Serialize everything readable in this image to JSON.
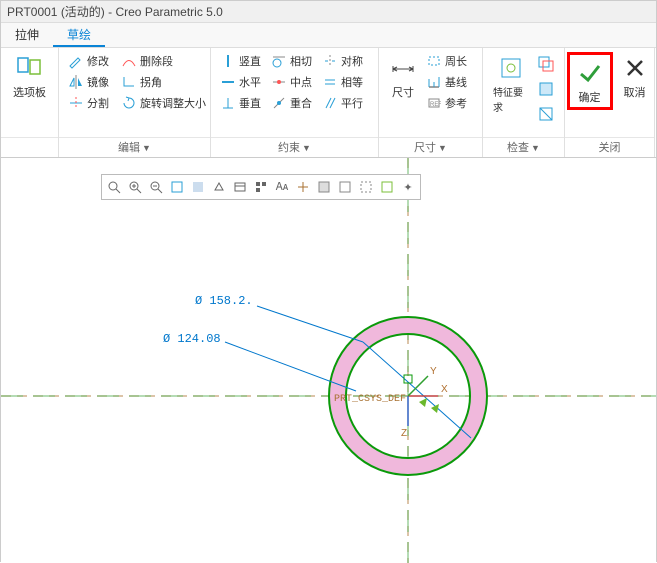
{
  "title": "PRT0001 (活动的) - Creo Parametric 5.0",
  "tabs": {
    "extrude": "拉伸",
    "sketch": "草绘"
  },
  "ribbon": {
    "options": {
      "label": "选项板"
    },
    "edit": {
      "label": "编辑",
      "modify": "修改",
      "delete_seg": "删除段",
      "mirror": "镜像",
      "corner": "拐角",
      "split": "分割",
      "rotate_resize": "旋转调整大小"
    },
    "constrain": {
      "label": "约束",
      "vertical": "竖直",
      "tangent": "相切",
      "symmetric": "对称",
      "horizontal": "水平",
      "midpoint": "中点",
      "equal": "相等",
      "perpendicular": "垂直",
      "coincident": "重合",
      "parallel": "平行"
    },
    "dimension": {
      "label": "尺寸",
      "perimeter": "周长",
      "baseline": "基线",
      "reference": "参考",
      "dim": "尺寸"
    },
    "inspect": {
      "label": "检查",
      "feature_req": "特征要求"
    },
    "close": {
      "label": "关闭",
      "ok": "确定",
      "cancel": "取消"
    }
  },
  "sketch": {
    "dim_outer": "Ø 158.2.",
    "dim_inner": "Ø 124.08",
    "csys": "PRT_CSYS_DEF",
    "axis_x": "X",
    "axis_y": "Y",
    "axis_z": "Z"
  }
}
